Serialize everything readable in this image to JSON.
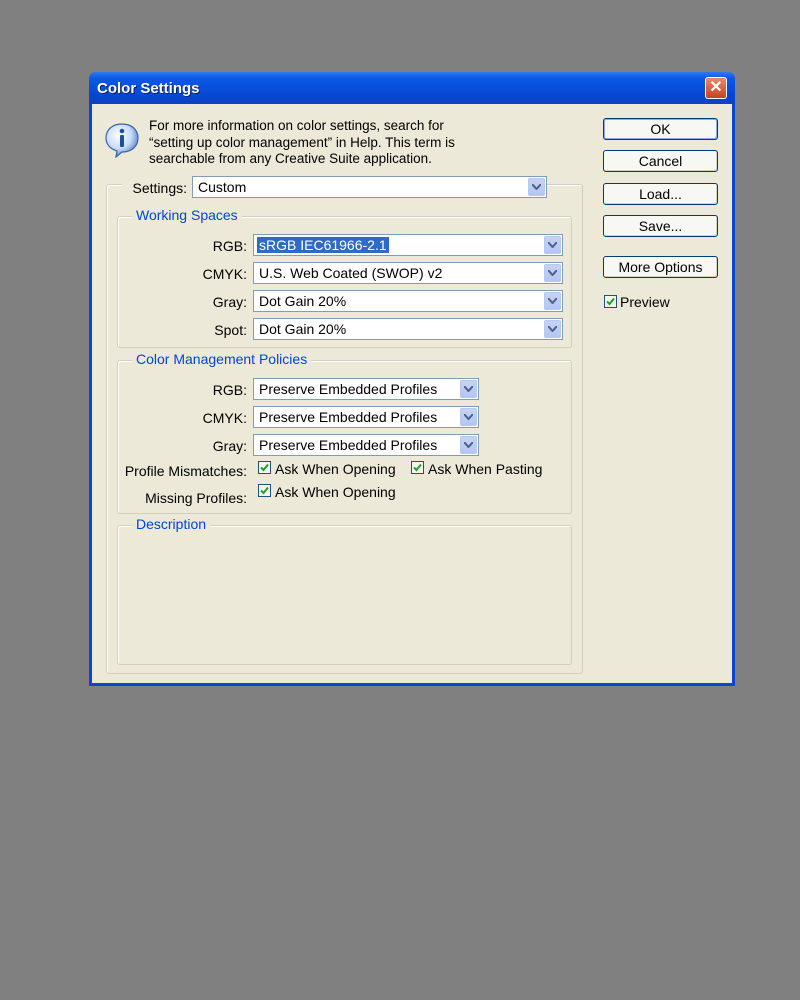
{
  "window": {
    "title": "Color Settings",
    "close_label": "✕"
  },
  "info": {
    "lines": [
      "For more information on color settings, search for",
      "“setting up color management” in Help. This term is",
      "searchable from any Creative Suite application."
    ]
  },
  "settings": {
    "label": "Settings:",
    "value": "Custom"
  },
  "working_spaces": {
    "legend": "Working Spaces",
    "rows": [
      {
        "label": "RGB:",
        "value": "sRGB IEC61966-2.1"
      },
      {
        "label": "CMYK:",
        "value": "U.S. Web Coated (SWOP) v2"
      },
      {
        "label": "Gray:",
        "value": "Dot Gain 20%"
      },
      {
        "label": "Spot:",
        "value": "Dot Gain 20%"
      }
    ]
  },
  "policies": {
    "legend": "Color Management Policies",
    "rows": [
      {
        "label": "RGB:",
        "value": "Preserve Embedded Profiles"
      },
      {
        "label": "CMYK:",
        "value": "Preserve Embedded Profiles"
      },
      {
        "label": "Gray:",
        "value": "Preserve Embedded Profiles"
      }
    ],
    "profile_mismatches": {
      "label": "Profile Mismatches:",
      "ask_opening": {
        "label": "Ask When Opening",
        "checked": true
      },
      "ask_pasting": {
        "label": "Ask When Pasting",
        "checked": true
      }
    },
    "missing_profiles": {
      "label": "Missing Profiles:",
      "ask_opening": {
        "label": "Ask When Opening",
        "checked": true
      }
    }
  },
  "description": {
    "legend": "Description",
    "text": ""
  },
  "buttons": {
    "ok": "OK",
    "cancel": "Cancel",
    "load": "Load...",
    "save": "Save...",
    "more_options": "More Options"
  },
  "preview": {
    "label": "Preview",
    "checked": true
  },
  "colors": {
    "desktop": "#808080",
    "face": "#ece9d8",
    "titlebar": "#0a46d6",
    "legend": "#0046d5",
    "selection": "#316ac5"
  }
}
